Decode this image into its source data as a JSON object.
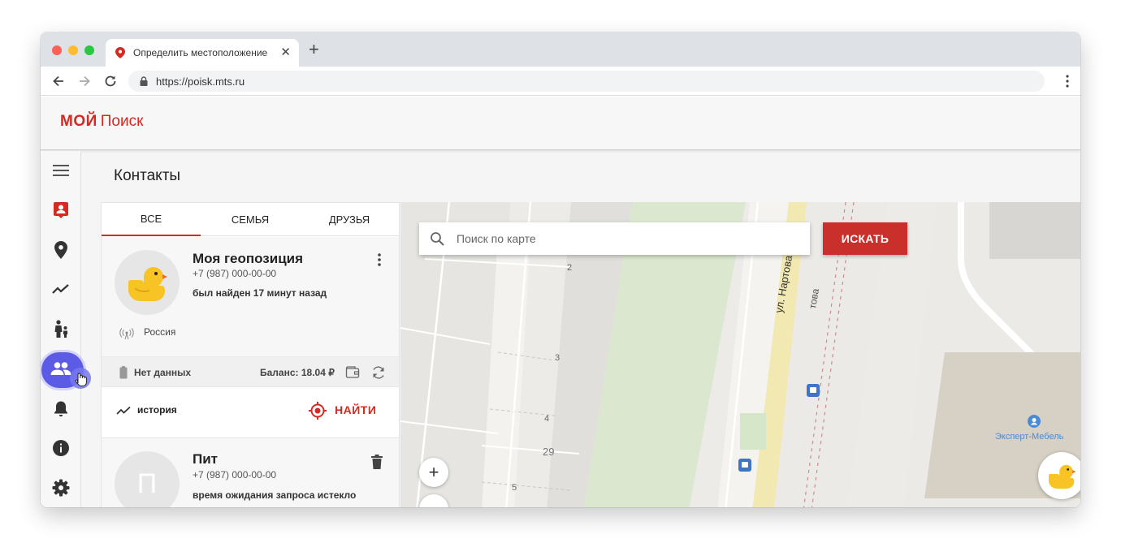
{
  "browser": {
    "tab_title": "Определить местоположение",
    "new_tab_symbol": "+",
    "close_symbol": "✕",
    "url": "https://poisk.mts.ru"
  },
  "app": {
    "logo_bold": "МОЙ",
    "logo_rest": "Поиск",
    "brand_color": "#d42a22"
  },
  "sidebar": {
    "items": [
      {
        "icon": "menu-icon"
      },
      {
        "icon": "contact-card-icon"
      },
      {
        "icon": "location-pin-icon"
      },
      {
        "icon": "trending-icon"
      },
      {
        "icon": "family-icon"
      },
      {
        "icon": "people-icon",
        "active": true
      },
      {
        "icon": "bell-icon"
      },
      {
        "icon": "info-icon"
      },
      {
        "icon": "gear-icon"
      }
    ]
  },
  "page": {
    "title": "Контакты"
  },
  "contacts": {
    "tabs": [
      "ВСЕ",
      "СЕМЬЯ",
      "ДРУЗЬЯ"
    ],
    "active_tab": 0,
    "items": [
      {
        "name": "Моя геопозиция",
        "phone": "+7 (987) 000-00-00",
        "status": "был найден 17 минут назад",
        "region": "Россия",
        "battery": "Нет данных",
        "balance": "Баланс: 18.04 ₽",
        "history_label": "история",
        "find_label": "НАЙТИ"
      },
      {
        "name": "Пит",
        "initial": "П",
        "phone": "+7 (987) 000-00-00",
        "status": "время ожидания запроса истекло"
      }
    ]
  },
  "map": {
    "search_placeholder": "Поиск по карте",
    "search_value": "",
    "search_button": "ИСКАТЬ",
    "zoom_in": "+",
    "zoom_out": "−",
    "street_name": "ул. Нартова",
    "street_name_partial": "това",
    "house_numbers": [
      "2",
      "3",
      "4",
      "5"
    ],
    "building_number": "29",
    "poi": "Эксперт-Мебель"
  }
}
